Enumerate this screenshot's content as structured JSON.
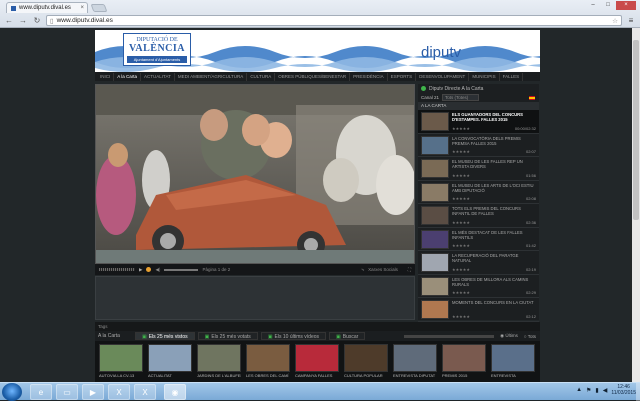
{
  "browser": {
    "tab_title": "www.diputv.dival.es",
    "url": "www.diputv.dival.es"
  },
  "banner": {
    "logo_line1": "DIPUTACIÓ DE",
    "logo_line2": "VALÈNCIA",
    "logo_line3": "Ajuntament d'Ajuntaments",
    "brand": "diputv",
    "brand_color": "#2a5da8"
  },
  "topnav": [
    {
      "label": "INICI",
      "active": false
    },
    {
      "label": "A la Carta",
      "active": true
    },
    {
      "label": "ACTUALITAT",
      "active": false
    },
    {
      "label": "MEDI AMBIENT/AGRICULTURA",
      "active": false
    },
    {
      "label": "CULTURA",
      "active": false
    },
    {
      "label": "OBRES PÚBLIQUES/BENESTAR",
      "active": false
    },
    {
      "label": "PRESIDÈNCIA",
      "active": false
    },
    {
      "label": "ESPORTS",
      "active": false
    },
    {
      "label": "DESENVOLUPAMENT",
      "active": false
    },
    {
      "label": "MUNICIPIS",
      "active": false
    },
    {
      "label": "FALLES",
      "active": false
    }
  ],
  "player": {
    "page_label": "Pàgina 1 de 2",
    "social_label": "Xarxes Socials"
  },
  "sidebar": {
    "header": "Diputv Directe A la Carta",
    "channel": "Canal 21",
    "select_value": "Tots (Totes)",
    "section": "A LA CARTA",
    "videos": [
      {
        "title": "ELS GUANYADORS DEL CONCURS D'ESTAMPES. FALLES 2015",
        "stars": "★★★★★",
        "duration": "00:00/02:32",
        "active": true,
        "thumb": "#6b5a4a"
      },
      {
        "title": "LA CONVOCATÒRIA DELS PREMIS PREMSA FALLES 2015",
        "stars": "★★★★★",
        "duration": "02:07",
        "active": false,
        "thumb": "#56708a"
      },
      {
        "title": "EL MUSEU DE LES FALLES REP UN ARTISTA DIVERS",
        "stars": "★★★★★",
        "duration": "01:56",
        "active": false,
        "thumb": "#7a6a55"
      },
      {
        "title": "EL MUSEU DE LES ARTS DE L'OCI ESTIU AMB DIPUTACIÓ",
        "stars": "★★★★★",
        "duration": "02:08",
        "active": false,
        "thumb": "#8a7b66"
      },
      {
        "title": "TOTS ELS PREMIS DEL CONCURS INFANTIL DE FALLES",
        "stars": "★★★★★",
        "duration": "02:36",
        "active": false,
        "thumb": "#5a4d44"
      },
      {
        "title": "EL MÉS DESTACAT DE LES FALLES INFANTILS",
        "stars": "★★★★★",
        "duration": "01:42",
        "active": false,
        "thumb": "#4b3f70"
      },
      {
        "title": "LA RECUPERACIÓ DEL PARATGE NATURAL",
        "stars": "★★★★★",
        "duration": "02:19",
        "active": false,
        "thumb": "#a0a6b0"
      },
      {
        "title": "LES OBRES DE MILLORA ALS CAMINS RURALS",
        "stars": "★★★★★",
        "duration": "02:29",
        "active": false,
        "thumb": "#9a8f7a"
      },
      {
        "title": "MOMENTS DEL CONCURS EN LA CIUTAT",
        "stars": "★★★★★",
        "duration": "02:12",
        "active": false,
        "thumb": "#b07850"
      }
    ]
  },
  "tags": {
    "label": "Tags"
  },
  "bottom": {
    "label": "A la Carta",
    "tabs": [
      {
        "label": "Els 25 més vistos",
        "active": true
      },
      {
        "label": "Els 25 més votats",
        "active": false
      },
      {
        "label": "Els 10 últims vídeos",
        "active": false
      },
      {
        "label": "Buscar",
        "active": false
      }
    ],
    "filter_a": "Últims",
    "filter_b": "Tots",
    "thumbs": [
      {
        "caption": "AUTOVIA LA CV-13",
        "color": "#6a8a5a"
      },
      {
        "caption": "ACTUALITAT",
        "color": "#8aa0b8"
      },
      {
        "caption": "JARDINS DE L'ALBUFERA",
        "color": "#6f7560"
      },
      {
        "caption": "LES OBRES DEL CAMÍ",
        "color": "#7a5c40"
      },
      {
        "caption": "CAMPANYA FALLES",
        "color": "#b82a3a"
      },
      {
        "caption": "CULTURA POPULAR",
        "color": "#4e3b2a"
      },
      {
        "caption": "ENTREVISTA DIPUTAT",
        "color": "#5f6b7a"
      },
      {
        "caption": "PREMIS 2015",
        "color": "#7a5a4f"
      },
      {
        "caption": "ENTREVISTA",
        "color": "#5a6f8a"
      }
    ]
  },
  "taskbar": {
    "time": "12:46",
    "date": "11/03/2015"
  }
}
